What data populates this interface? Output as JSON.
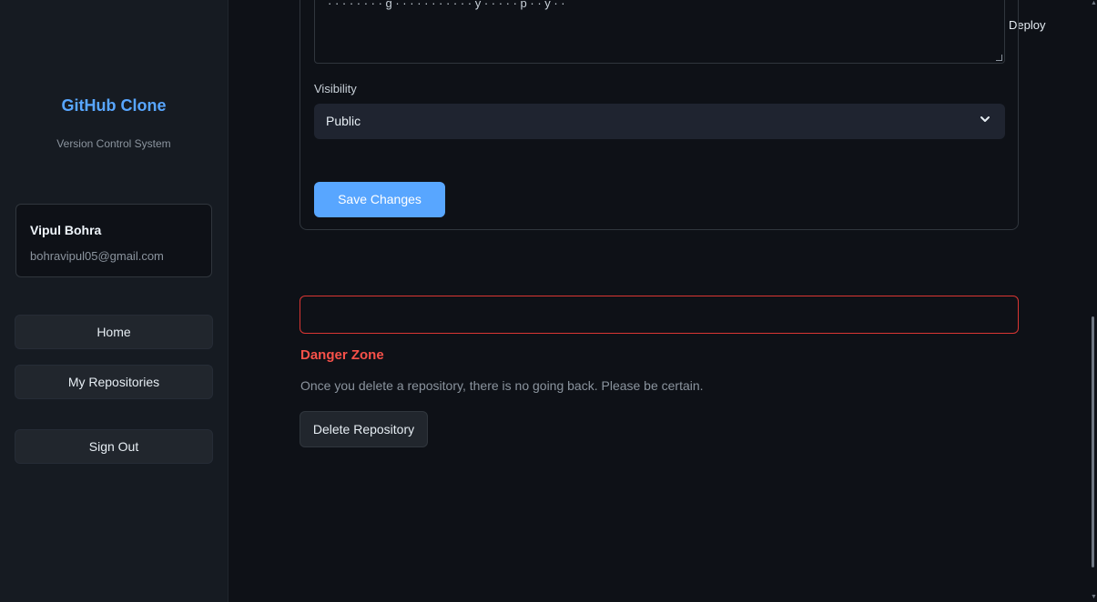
{
  "sidebar": {
    "title": "GitHub Clone",
    "subtitle": "Version Control System",
    "user": {
      "name": "Vipul Bohra",
      "email": "bohravipul05@gmail.com"
    },
    "nav": [
      {
        "label": "Home"
      },
      {
        "label": "My Repositories"
      },
      {
        "label": "Sign Out"
      }
    ]
  },
  "header": {
    "deploy_label": "Deploy"
  },
  "form": {
    "description_visible_text": "· · · · · · · · g · · · · · · · · · · · y · · · · · p · · y · ·",
    "visibility_label": "Visibility",
    "visibility_value": "Public",
    "save_label": "Save Changes"
  },
  "danger": {
    "title": "Danger Zone",
    "text": "Once you delete a repository, there is no going back. Please be certain.",
    "delete_label": "Delete Repository"
  },
  "colors": {
    "accent": "#58a6ff",
    "danger": "#f85149",
    "background": "#0e1117",
    "sidebar": "#161b22"
  }
}
